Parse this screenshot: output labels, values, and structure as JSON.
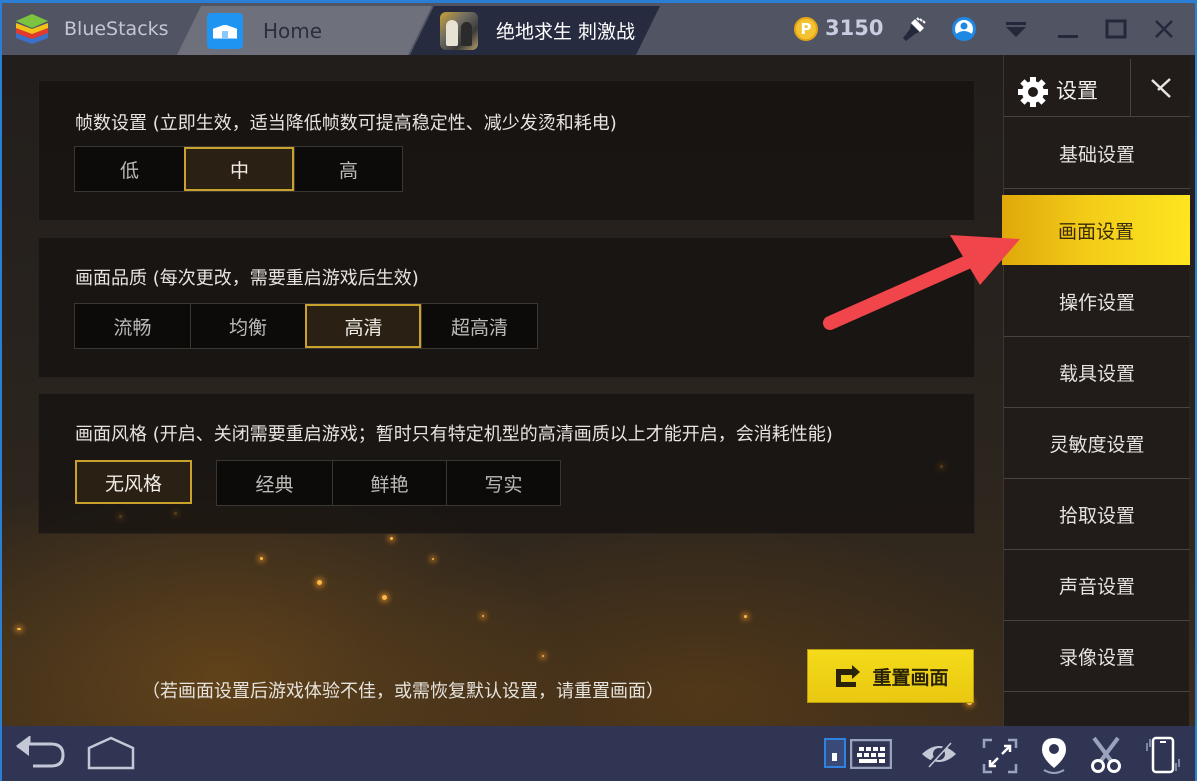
{
  "titlebar": {
    "brand": "BlueStacks",
    "tabs": [
      {
        "label": "Home",
        "icon": "home-icon"
      },
      {
        "label": "绝地求生 刺激战场",
        "icon": "game-icon"
      }
    ],
    "coin_symbol": "P",
    "coin_count": "3150",
    "icons": [
      "brush-icon",
      "user-icon",
      "menu-icon",
      "minimize-icon",
      "maximize-icon",
      "close-icon"
    ]
  },
  "settings": {
    "sections": [
      {
        "title": "帧数设置 (立即生效，适当降低帧数可提高稳定性、减少发烫和耗电)",
        "options": [
          "低",
          "中",
          "高"
        ],
        "selected": "中"
      },
      {
        "title": "画面品质 (每次更改，需要重启游戏后生效)",
        "options": [
          "流畅",
          "均衡",
          "高清",
          "超高清"
        ],
        "selected": "高清"
      },
      {
        "title": "画面风格 (开启、关闭需要重启游戏；暂时只有特定机型的高清画质以上才能开启，会消耗性能)",
        "options": [
          "无风格",
          "经典",
          "鲜艳",
          "写实"
        ],
        "selected": "无风格"
      }
    ],
    "footer_note": "（若画面设置后游戏体验不佳，或需恢复默认设置，请重置画面）",
    "reset_button": "重置画面"
  },
  "side_menu": {
    "title": "设置",
    "items": [
      "基础设置",
      "画面设置",
      "操作设置",
      "载具设置",
      "灵敏度设置",
      "拾取设置",
      "声音设置",
      "录像设置"
    ],
    "active": "画面设置"
  },
  "colors": {
    "accent_yellow": "#f3cc18",
    "selected_border": "#c9a22e",
    "annotation_arrow": "#f0454a",
    "brand_blue": "#1f94f0"
  },
  "bottombar": {
    "left_icons": [
      "back-icon",
      "home-icon"
    ],
    "right_icons": [
      "keyboard-toggle-icon",
      "keyboard-icon",
      "eye-off-icon",
      "fullscreen-icon",
      "location-icon",
      "scissors-icon",
      "shake-icon"
    ]
  }
}
